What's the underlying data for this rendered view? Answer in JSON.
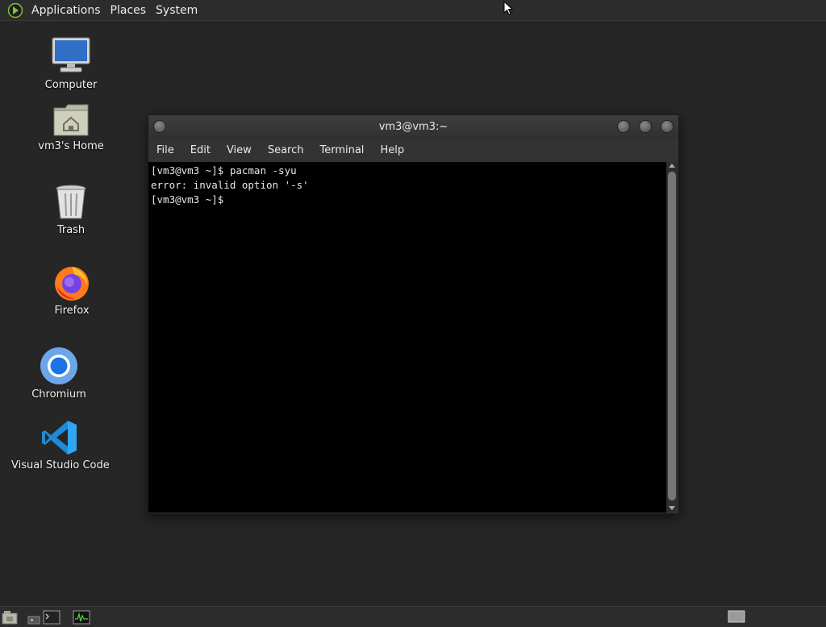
{
  "top_panel": {
    "menus": [
      "Applications",
      "Places",
      "System"
    ]
  },
  "desktop": {
    "icons": [
      {
        "label": "Computer",
        "icon": "computer-icon"
      },
      {
        "label": "vm3's Home",
        "icon": "home-folder-icon"
      },
      {
        "label": "Trash",
        "icon": "trash-icon"
      },
      {
        "label": "Firefox",
        "icon": "firefox-icon"
      },
      {
        "label": "Chromium",
        "icon": "chromium-icon"
      },
      {
        "label": "Visual Studio Code",
        "icon": "vscode-icon"
      }
    ]
  },
  "terminal": {
    "title": "vm3@vm3:~",
    "menu": [
      "File",
      "Edit",
      "View",
      "Search",
      "Terminal",
      "Help"
    ],
    "lines": [
      "[vm3@vm3 ~]$ pacman -syu",
      "error: invalid option '-s'",
      "[vm3@vm3 ~]$"
    ]
  },
  "bottom_panel": {
    "icons": [
      "show-desktop-icon",
      "terminal-launcher-icon",
      "system-monitor-icon",
      "workspace-switcher-icon"
    ]
  },
  "colors": {
    "desktop_bg": "#262626",
    "panel_bg": "#2c2c2c",
    "terminal_bg": "#000000",
    "accent_green": "#7fbf3f"
  }
}
